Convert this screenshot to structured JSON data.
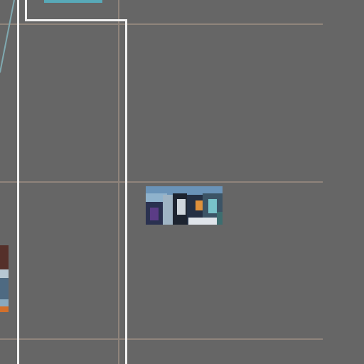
{
  "canvas": {
    "background": "#666666",
    "guide_color": "#8f847b",
    "frame_color": "#f2f2f2",
    "accent_teal": "#58a9b8"
  },
  "items": {
    "top_thumbnail": "teal-thumbnail-partial",
    "center_thumbnail": "photo-thumbnail",
    "left_thumbnail": "photo-thumbnail-partial"
  }
}
